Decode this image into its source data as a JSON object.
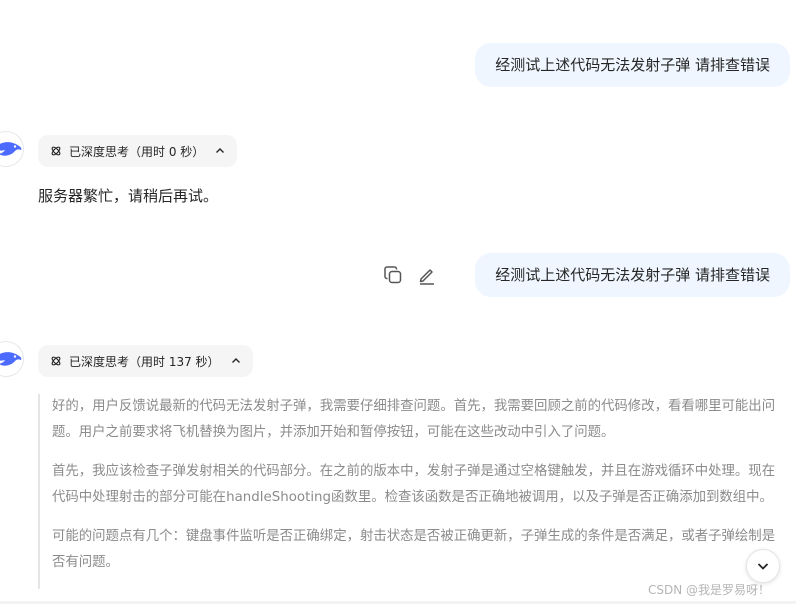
{
  "conversation": {
    "user_message_1": "经测试上述代码无法发射子弹  请排查错误",
    "assistant_1": {
      "think_label": "已深度思考（用时 0 秒）",
      "reply": "服务器繁忙，请稍后再试。"
    },
    "user_message_2": "经测试上述代码无法发射子弹  请排查错误",
    "assistant_2": {
      "think_label": "已深度思考（用时 137 秒）",
      "paragraphs": [
        "好的，用户反馈说最新的代码无法发射子弹，我需要仔细排查问题。首先，我需要回顾之前的代码修改，看看哪里可能出问题。用户之前要求将飞机替换为图片，并添加开始和暂停按钮，可能在这些改动中引入了问题。",
        "首先，我应该检查子弹发射相关的代码部分。在之前的版本中，发射子弹是通过空格键触发，并且在游戏循环中处理。现在代码中处理射击的部分可能在handleShooting函数里。检查该函数是否正确地被调用，以及子弹是否正确添加到数组中。",
        "可能的问题点有几个：键盘事件监听是否正确绑定，射击状态是否被正确更新，子弹生成的条件是否满足，或者子弹绘制是否有问题。"
      ]
    }
  },
  "watermark": "CSDN @我是罗易呀！",
  "icons": {
    "avatar": "deepseek-whale-icon",
    "think": "deep-think-atom-icon",
    "collapse": "chevron-up-icon",
    "copy": "copy-icon",
    "edit": "edit-pencil-icon",
    "scroll": "chevron-down-icon"
  },
  "colors": {
    "user_bubble": "#eff6ff",
    "accent": "#4d6bfe",
    "thinking_text": "#8b8b8b"
  }
}
